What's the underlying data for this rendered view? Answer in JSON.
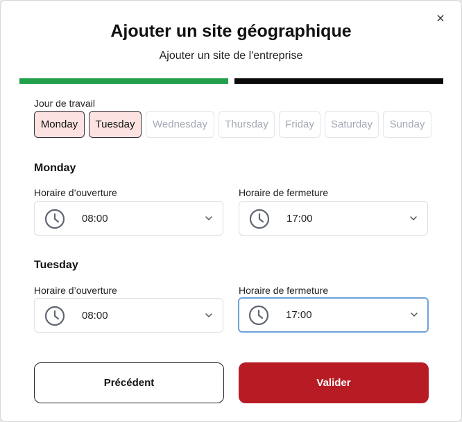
{
  "dialog": {
    "close_glyph": "×",
    "title": "Ajouter un site géographique",
    "subtitle": "Ajouter un site de l'entreprise"
  },
  "progress": {
    "steps": 2,
    "colors": [
      "#22a04b",
      "#0a0a0a"
    ]
  },
  "working_days": {
    "label": "Jour de travail",
    "days": [
      {
        "label": "Monday",
        "selected": true
      },
      {
        "label": "Tuesday",
        "selected": true
      },
      {
        "label": "Wednesday",
        "selected": false
      },
      {
        "label": "Thursday",
        "selected": false
      },
      {
        "label": "Friday",
        "selected": false
      },
      {
        "label": "Saturday",
        "selected": false
      },
      {
        "label": "Sunday",
        "selected": false
      }
    ]
  },
  "schedule": [
    {
      "day": "Monday",
      "opening_label": "Horaire d’ouverture",
      "opening_time": "08:00",
      "closing_label": "Horaire de fermeture",
      "closing_time": "17:00"
    },
    {
      "day": "Tuesday",
      "opening_label": "Horaire d’ouverture",
      "opening_time": "08:00",
      "closing_label": "Horaire de fermeture",
      "closing_time": "17:00"
    }
  ],
  "icons": {
    "clock": "clock-icon",
    "chevron": "chevron-down-icon",
    "close": "close-icon"
  },
  "buttons": {
    "previous": "Précédent",
    "submit": "Valider"
  },
  "colors": {
    "primary": "#b71c24",
    "selected_day_bg": "#fde2e2",
    "progress_done": "#22a04b",
    "focus_border": "#6fa3d8"
  }
}
